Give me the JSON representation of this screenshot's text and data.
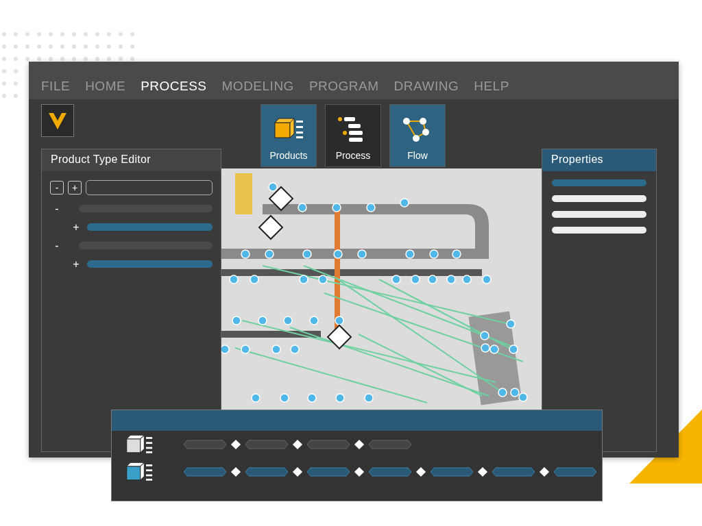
{
  "menu": [
    {
      "label": "FILE",
      "selected": false
    },
    {
      "label": "HOME",
      "selected": false
    },
    {
      "label": "PROCESS",
      "selected": true
    },
    {
      "label": "MODELING",
      "selected": false
    },
    {
      "label": "PROGRAM",
      "selected": false
    },
    {
      "label": "DRAWING",
      "selected": false
    },
    {
      "label": "HELP",
      "selected": false
    }
  ],
  "ribbon": [
    {
      "kind": "products",
      "label": "Products",
      "selected": true
    },
    {
      "kind": "process",
      "label": "Process",
      "selected": false
    },
    {
      "kind": "flow",
      "label": "Flow",
      "selected": true
    }
  ],
  "editor": {
    "title": "Product Type Editor",
    "collapse_button": "-",
    "expand_button": "+",
    "tree": [
      {
        "toggle": "-",
        "selected": false,
        "children": [
          {
            "toggle": "+",
            "selected": true
          }
        ]
      },
      {
        "toggle": "-",
        "selected": false,
        "children": [
          {
            "toggle": "+",
            "selected": true
          }
        ]
      }
    ]
  },
  "properties": {
    "title": "Properties",
    "rows": [
      {
        "selected": true
      },
      {
        "selected": false
      },
      {
        "selected": false
      },
      {
        "selected": false
      }
    ]
  },
  "sequence": {
    "rows": [
      {
        "selected": false,
        "steps": [
          {
            "selected": false
          },
          {
            "selected": false
          },
          {
            "selected": false
          },
          {
            "selected": false
          }
        ]
      },
      {
        "selected": true,
        "steps": [
          {
            "selected": true
          },
          {
            "selected": true
          },
          {
            "selected": true
          },
          {
            "selected": true
          },
          {
            "selected": true
          },
          {
            "selected": true
          },
          {
            "selected": true
          }
        ]
      }
    ]
  }
}
